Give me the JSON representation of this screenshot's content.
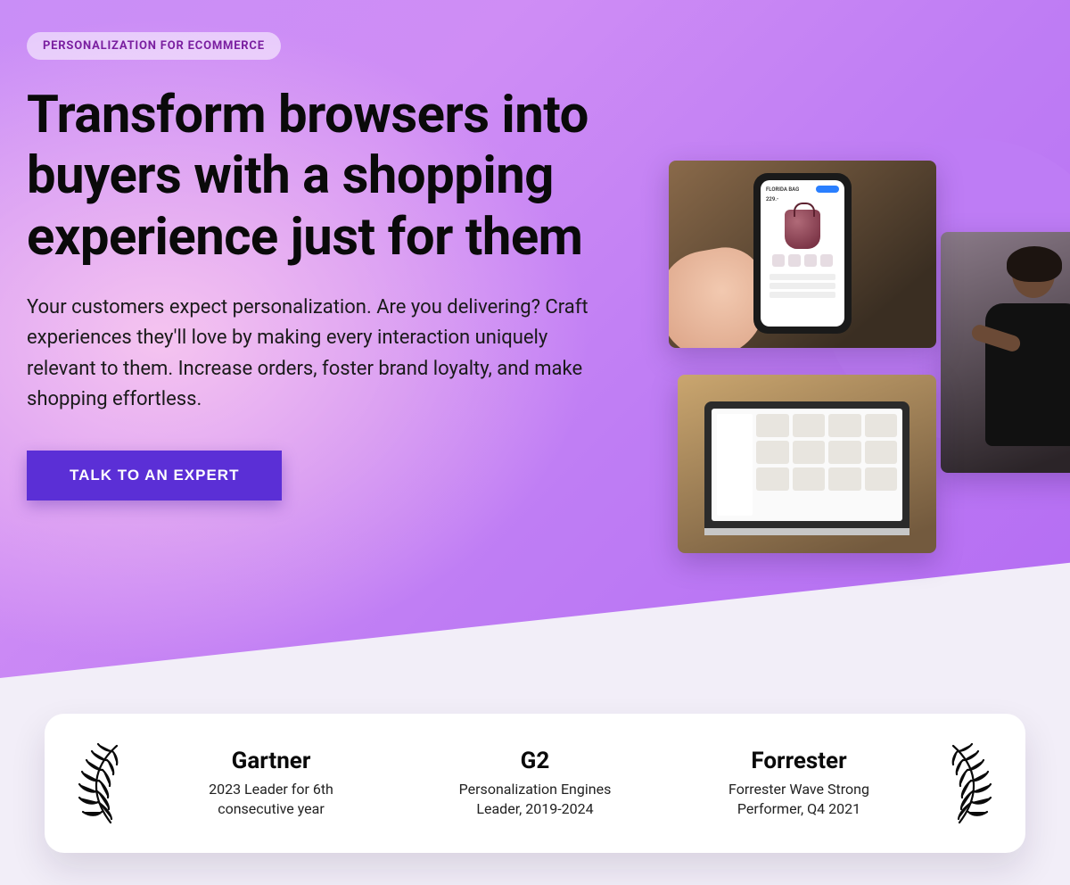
{
  "hero": {
    "eyebrow": "PERSONALIZATION FOR ECOMMERCE",
    "headline": "Transform browsers into buyers with a shopping experience just for them",
    "subtext": "Your customers expect personalization. Are you delivering? Craft experiences they'll love by making every interaction uniquely relevant to them. Increase orders, foster brand loyalty, and make shopping effortless.",
    "cta_label": "TALK TO AN EXPERT"
  },
  "hero_images": {
    "phone_alt": "Phone showing handbag product page",
    "laptop_alt": "Laptop showing product grid",
    "shopper_alt": "Woman browsing clothing rack",
    "phone_product_label": "FLORIDA BAG",
    "phone_product_price": "229.-"
  },
  "awards": [
    {
      "title": "Gartner",
      "description": "2023 Leader for 6th consecutive year"
    },
    {
      "title": "G2",
      "description": "Personalization Engines Leader, 2019-2024"
    },
    {
      "title": "Forrester",
      "description": "Forrester Wave Strong Performer, Q4 2021"
    }
  ]
}
